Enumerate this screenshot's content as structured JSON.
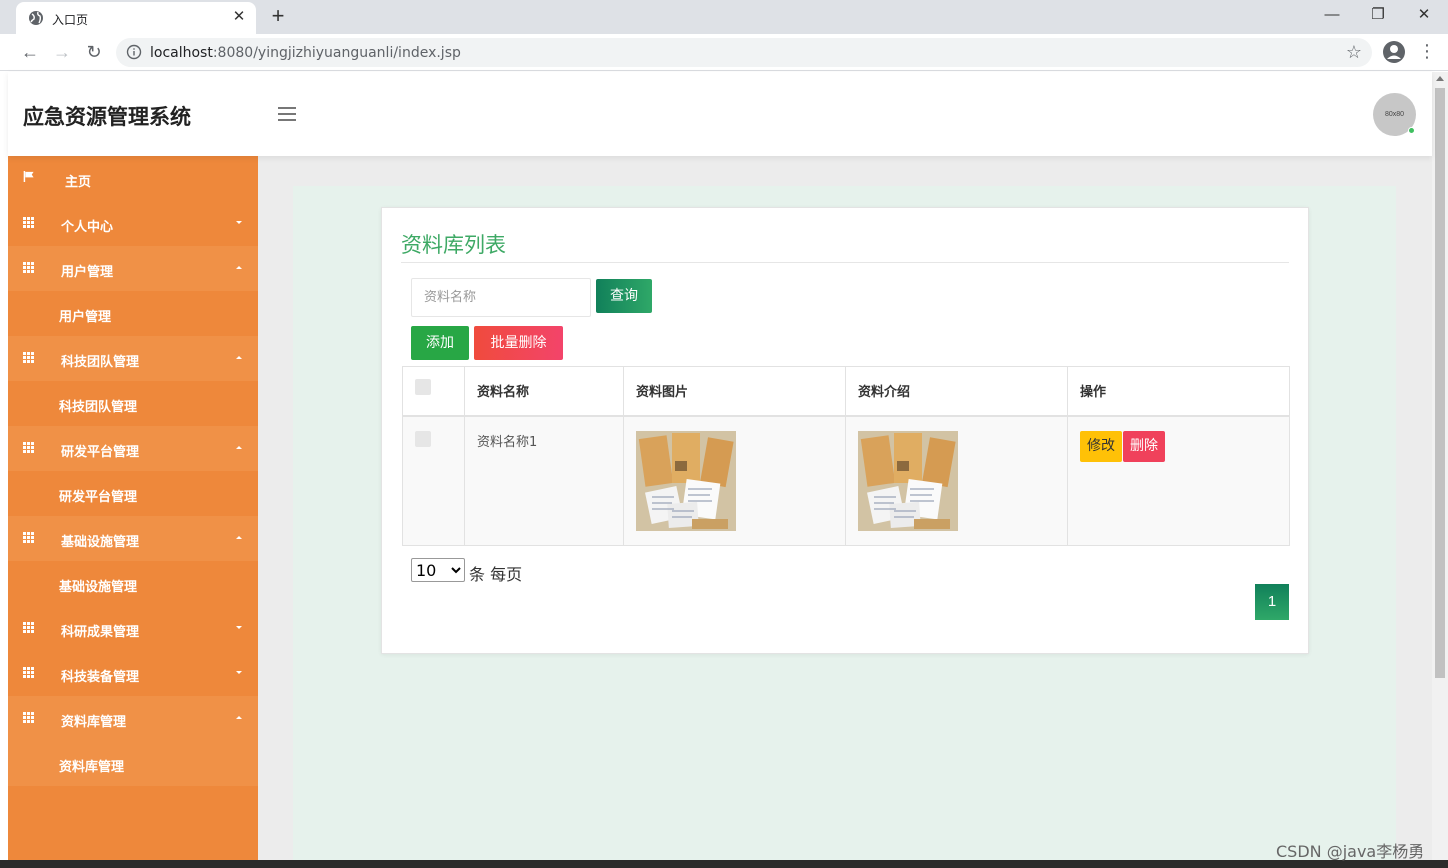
{
  "browser": {
    "tab_title": "入口页",
    "url_host": "localhost",
    "url_path": ":8080/yingjizhiyuanguanli/index.jsp"
  },
  "header": {
    "app_title": "应急资源管理系统",
    "avatar_text": "80x80"
  },
  "sidebar": {
    "items": [
      {
        "label": "主页"
      },
      {
        "label": "个人中心"
      },
      {
        "label": "用户管理"
      },
      {
        "label": "用户管理"
      },
      {
        "label": "科技团队管理"
      },
      {
        "label": "科技团队管理"
      },
      {
        "label": "研发平台管理"
      },
      {
        "label": "研发平台管理"
      },
      {
        "label": "基础设施管理"
      },
      {
        "label": "基础设施管理"
      },
      {
        "label": "科研成果管理"
      },
      {
        "label": "科技装备管理"
      },
      {
        "label": "资料库管理"
      },
      {
        "label": "资料库管理"
      }
    ]
  },
  "main": {
    "title": "资料库列表",
    "search_placeholder": "资料名称",
    "query_label": "查询",
    "add_label": "添加",
    "batch_delete_label": "批量删除",
    "columns": [
      "资料名称",
      "资料图片",
      "资料介绍",
      "操作"
    ],
    "rows": [
      {
        "name": "资料名称1",
        "edit_label": "修改",
        "delete_label": "删除"
      }
    ],
    "page_size": "10",
    "page_size_suffix": "条 每页",
    "current_page": "1"
  },
  "watermark": "CSDN @java李杨勇",
  "colors": {
    "sidebar": "#ee883b",
    "accent_green": "#3ea965",
    "edit_yellow": "#ffc107",
    "delete_red": "#f0415b"
  }
}
